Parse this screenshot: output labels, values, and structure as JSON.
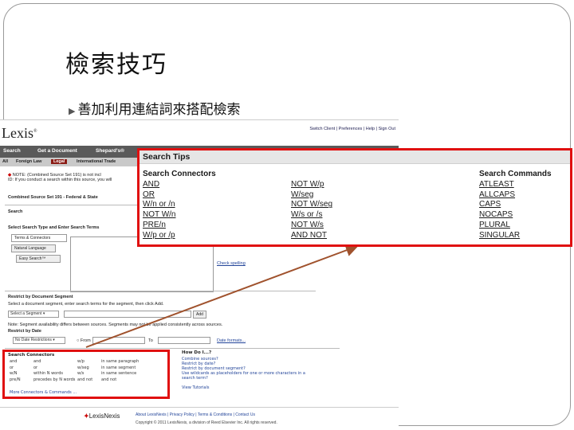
{
  "slide": {
    "title": "檢索技巧",
    "bullet": "善加利用連結詞來搭配檢索"
  },
  "lexis": {
    "logo": "Lexis",
    "toplinks": "Switch Client | Preferences | Help | Sign Out",
    "nav": [
      "Search",
      "Get a Document",
      "Shepard's®"
    ],
    "tabs": [
      "All",
      "Foreign Law",
      "Legal",
      "International Trade"
    ],
    "note": "NOTE: (Combined Source Set 191) is not incl",
    "note2": "ID: If you conduct a search within this source, you will",
    "source": "Combined Source Set 191 - Federal & State",
    "search_label": "Search",
    "select_search_type": "Select Search Type and Enter Search Terms",
    "search_types": [
      "Terms & Connectors",
      "Natural Language",
      "Easy Search™"
    ],
    "check_spelling": "Check spelling",
    "restrict_segment": "Restrict by Document Segment",
    "segment_hint": "Select a document segment, enter search terms for the segment, then click Add.",
    "segment_select": "Select a Segment",
    "add_btn": "Add",
    "segment_note": "Note: Segment availability differs between sources. Segments may not be applied consistently across sources.",
    "restrict_date": "Restrict by Date",
    "date_select": "No Date Restrictions",
    "from_label": "From",
    "to_label": "To",
    "date_formats": "Date formats...",
    "footer_brand": "LexisNexis",
    "footer_links": "About LexisNexis | Privacy Policy | Terms & Conditions | Contact Us",
    "footer_copy": "Copyright © 2011 LexisNexis, a division of Reed Elsevier Inc. All rights reserved."
  },
  "small_connectors": {
    "title": "Search Connectors",
    "rows": [
      [
        "and",
        "and",
        "w/p",
        "in same paragraph"
      ],
      [
        "or",
        "or",
        "w/seg",
        "in same segment"
      ],
      [
        "w/N",
        "within N words",
        "w/s",
        "in same sentence"
      ],
      [
        "pre/N",
        "precedes by N words",
        "and not",
        "and not"
      ]
    ],
    "more": "More Connectors & Commands ..."
  },
  "how_do_i": {
    "title": "How Do I...?",
    "links": [
      "Combine sources?",
      "Restrict by date?",
      "Restrict by document segment?",
      "Use wildcards as placeholders for one or more characters in a search term?",
      "View Tutorials"
    ]
  },
  "search_tips": {
    "title": "Search Tips",
    "connectors_head": "Search Connectors",
    "col1": [
      "AND",
      "OR",
      "W/n or /n",
      "NOT W/n",
      "PRE/n",
      "W/p or /p"
    ],
    "col2": [
      "NOT W/p",
      "W/seg",
      "NOT W/seg",
      "W/s or /s",
      "NOT W/s",
      "AND NOT"
    ],
    "commands_head": "Search Commands",
    "col3": [
      "ATLEAST",
      "ALLCAPS",
      "CAPS",
      "NOCAPS",
      "PLURAL",
      "SINGULAR"
    ]
  },
  "colors": {
    "highlight_border": "#e01010",
    "arrow": "#a0522d",
    "nav_bar": "#5a5a5a",
    "active_tab": "#8a1b14"
  }
}
